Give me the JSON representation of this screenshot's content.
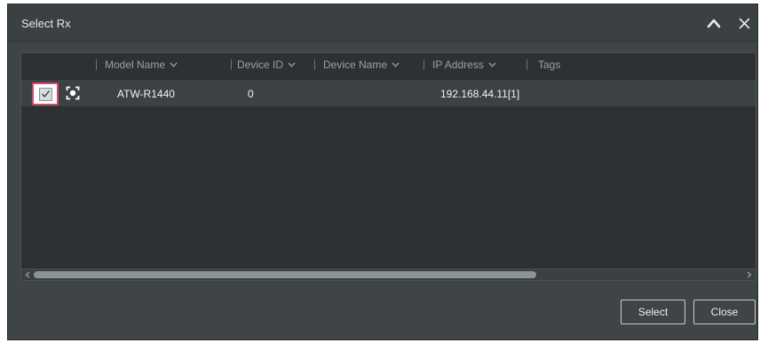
{
  "window": {
    "title": "Select Rx"
  },
  "columns": [
    {
      "label": "Model Name"
    },
    {
      "label": "Device ID"
    },
    {
      "label": "Device Name"
    },
    {
      "label": "IP Address"
    },
    {
      "label": "Tags"
    }
  ],
  "rows": [
    {
      "checked": true,
      "model_name": "ATW-R1440",
      "device_id": "0",
      "device_name": "",
      "ip_address": "192.168.44.11[1]",
      "tags": ""
    }
  ],
  "buttons": {
    "select_label": "Select",
    "close_label": "Close"
  },
  "icons": {
    "collapse": "chevron-up-icon",
    "close": "close-icon",
    "locate": "locate-device-icon",
    "sort": "chevron-down-icon"
  },
  "colors": {
    "window_bg": "#3f4446",
    "list_bg": "#2d3133",
    "row_bg": "#3c4244",
    "highlight": "#d14a66"
  }
}
